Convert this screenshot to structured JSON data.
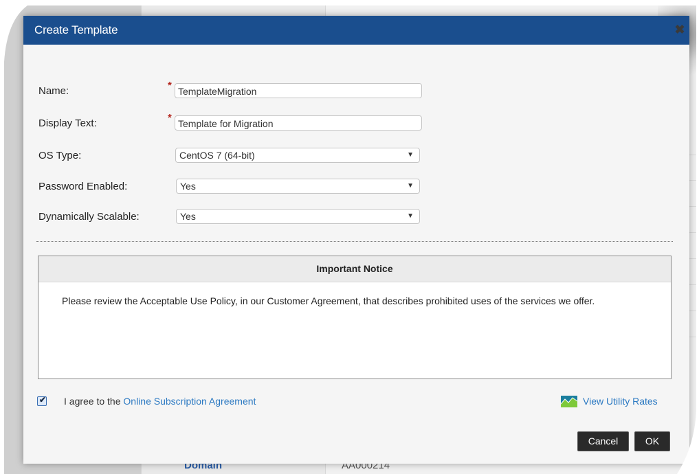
{
  "background": {
    "domain_label": "Domain",
    "account_code": "AA000214"
  },
  "dialog": {
    "title": "Create Template",
    "close_icon": "close-icon"
  },
  "form": {
    "name_label": "Name:",
    "name_value": "TemplateMigration",
    "display_text_label": "Display Text:",
    "display_text_value": "Template for Migration",
    "os_type_label": "OS Type:",
    "os_type_value": "CentOS 7 (64-bit)",
    "password_enabled_label": "Password Enabled:",
    "password_enabled_value": "Yes",
    "dynamically_scalable_label": "Dynamically Scalable:",
    "dynamically_scalable_value": "Yes",
    "required_marker": "*"
  },
  "notice": {
    "title": "Important Notice",
    "body": "Please review the Acceptable Use Policy, in our Customer Agreement, that describes prohibited uses of the services we offer."
  },
  "agreement": {
    "prefix": "I agree to the",
    "link_text": "Online Subscription Agreement",
    "checked": true,
    "utility_link": "View Utility Rates",
    "utility_icon": "chart-icon"
  },
  "buttons": {
    "cancel": "Cancel",
    "ok": "OK"
  },
  "colors": {
    "header_bg": "#1a4e8e",
    "link": "#2b79c2",
    "button_bg": "#2a2a2a",
    "required": "#b3261e"
  }
}
